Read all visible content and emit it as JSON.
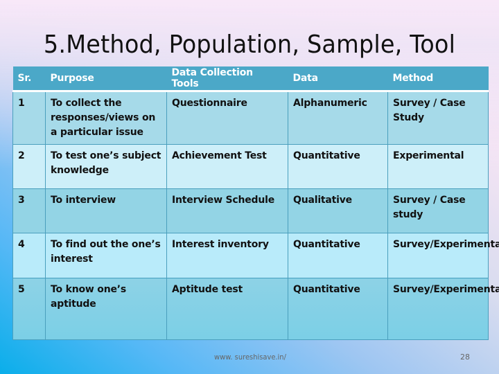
{
  "slide": {
    "title": "5.Method, Population, Sample, Tool",
    "footer_url": "www. sureshisave.in/",
    "page_number": "28"
  },
  "table": {
    "headers": [
      "Sr.",
      "Purpose",
      "Data Collection Tools",
      "Data",
      "Method"
    ],
    "rows": [
      [
        "1",
        "To collect the responses/views on a particular issue",
        "Questionnaire",
        "Alphanumeric",
        "Survey / Case Study"
      ],
      [
        "2",
        "To test one’s subject knowledge",
        "Achievement Test",
        "Quantitative",
        "Experimental"
      ],
      [
        "3",
        "To interview",
        "Interview Schedule",
        "Qualitative",
        "Survey / Case study"
      ],
      [
        "4",
        "To find out the one’s interest",
        "Interest inventory",
        "Quantitative",
        "Survey/Experimental"
      ],
      [
        "5",
        "To know one’s aptitude",
        "Aptitude test",
        "Quantitative",
        "Survey/Experimental"
      ]
    ]
  },
  "colors": {
    "header_bg": "#4ba8c8",
    "border": "#4a9fbd"
  }
}
